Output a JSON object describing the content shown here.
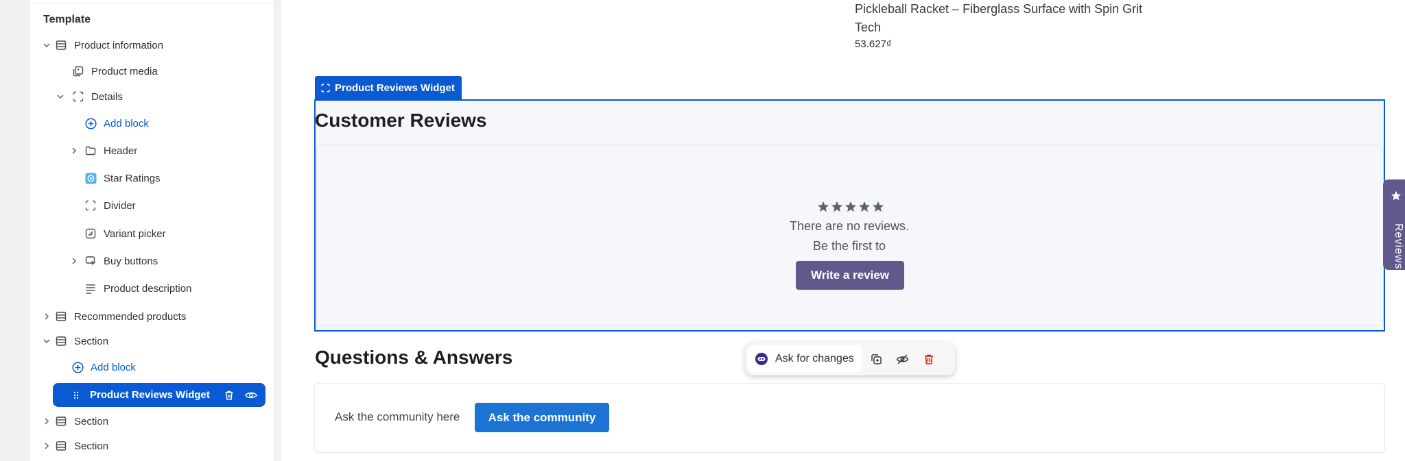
{
  "sidebar": {
    "title": "Template",
    "rows": {
      "product_information": "Product information",
      "product_media": "Product media",
      "details": "Details",
      "add_block_1": "Add block",
      "header": "Header",
      "star_ratings": "Star Ratings",
      "divider": "Divider",
      "variant_picker": "Variant picker",
      "buy_buttons": "Buy buttons",
      "product_description": "Product description",
      "recommended_products": "Recommended products",
      "section_1": "Section",
      "add_block_2": "Add block",
      "selected": "Product Reviews Widget",
      "section_2": "Section",
      "section_3": "Section"
    },
    "accent_color": "#0a5ad4"
  },
  "preview": {
    "product_title": "Pickleball Racket – Fiberglass Surface with Spin Grit Tech",
    "product_price": "53.627₫",
    "widget_tag": "Product Reviews Widget",
    "reviews": {
      "heading": "Customer Reviews",
      "no_reviews": "There are no reviews.",
      "be_first": "Be the first to",
      "write_button": "Write a review",
      "button_color": "#5f5a8b"
    },
    "qa": {
      "heading": "Questions & Answers",
      "prompt": "Ask the community here",
      "button": "Ask the community",
      "button_color": "#1b74d4"
    },
    "toolbar": {
      "ask_label": "Ask for changes",
      "icons": [
        "duplicate-icon",
        "hide-icon",
        "delete-icon"
      ]
    },
    "side_tab": "Reviews"
  }
}
